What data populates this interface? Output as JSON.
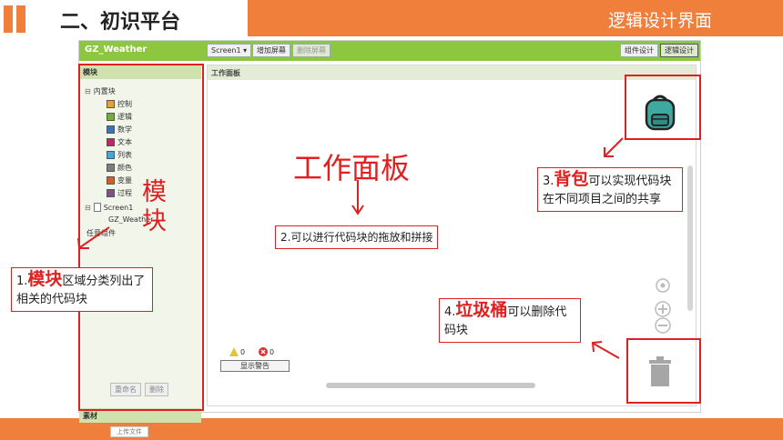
{
  "slide": {
    "title": "二、初识平台",
    "section": "逻辑设计界面"
  },
  "toolbar": {
    "app_name": "GZ_Weather",
    "screen_dropdown": "Screen1 ▾",
    "add_screen": "增加屏幕",
    "remove_screen": "删除屏幕",
    "designer": "组件设计",
    "blocks": "逻辑设计"
  },
  "blocks_panel": {
    "title": "模块",
    "builtin": "内置块",
    "categories": [
      {
        "label": "控制",
        "color": "#e1a33a"
      },
      {
        "label": "逻辑",
        "color": "#77ab41"
      },
      {
        "label": "数学",
        "color": "#3f71b5"
      },
      {
        "label": "文本",
        "color": "#b32d5e"
      },
      {
        "label": "列表",
        "color": "#49a6d4"
      },
      {
        "label": "颜色",
        "color": "#7d7d7d"
      },
      {
        "label": "变量",
        "color": "#d05f2d"
      },
      {
        "label": "过程",
        "color": "#7c5385"
      }
    ],
    "screen": "Screen1",
    "component": "GZ_Weather",
    "any_component": "任意组件",
    "rename": "重命名",
    "delete": "删除",
    "media": "素材",
    "media_sub": "上传文件"
  },
  "viewer": {
    "title": "工作面板",
    "warnings_count": "0",
    "errors_count": "0",
    "show_warnings": "显示警告"
  },
  "annotations": {
    "viewer_big": "工作面板",
    "viewer_desc": "2.可以进行代码块的拖放和拼接",
    "blocks_big": "模块",
    "blocks_prefix": "1.",
    "blocks_hl": "模块",
    "blocks_rest": "区域分类列出了相关的代码块",
    "backpack_prefix": "3.",
    "backpack_hl": "背包",
    "backpack_rest": "可以实现代码块在不同项目之间的共享",
    "trash_prefix": "4.",
    "trash_hl": "垃圾桶",
    "trash_rest": "可以删除代码块"
  },
  "colors": {
    "accent_orange": "#f07f3c",
    "appinventor_green": "#8dc63f",
    "annotation_red": "#e02020"
  }
}
